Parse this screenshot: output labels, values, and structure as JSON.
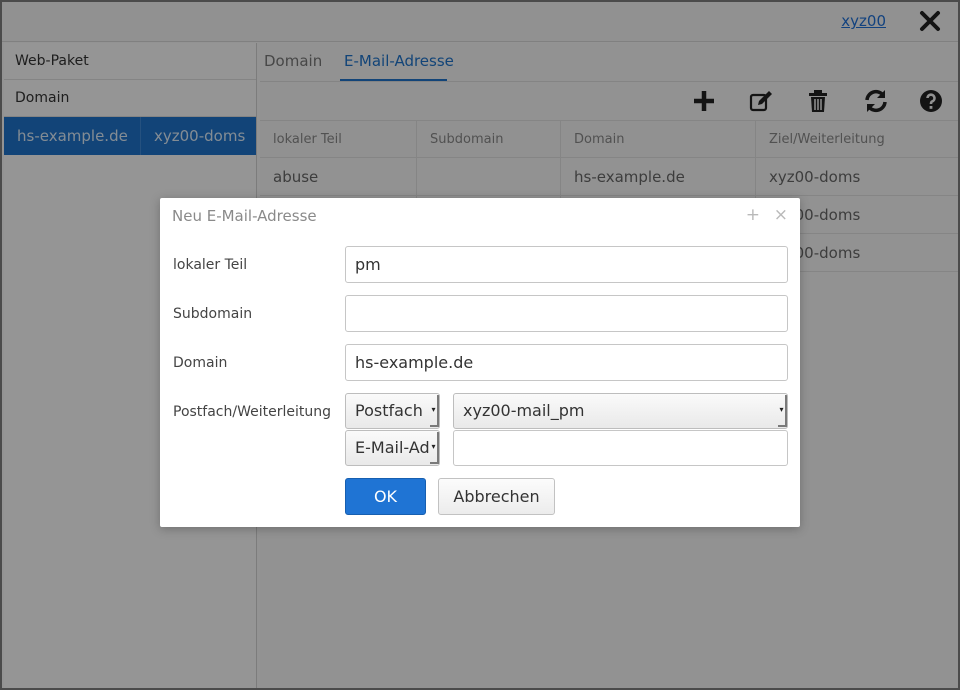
{
  "header": {
    "user": "xyz00",
    "close_icon": "close-icon"
  },
  "sidebar": {
    "items": [
      {
        "label": "Web-Paket"
      },
      {
        "label": "Domain"
      }
    ],
    "selected_row": {
      "domain": "hs-example.de",
      "owner": "xyz00-doms"
    }
  },
  "main": {
    "tabs": [
      {
        "label": "Domain",
        "active": false
      },
      {
        "label": "E-Mail-Adresse",
        "active": true
      }
    ],
    "toolbar": [
      "plus-icon",
      "edit-icon",
      "trash-icon",
      "refresh-icon",
      "help-icon"
    ],
    "table": {
      "columns": [
        "lokaler Teil",
        "Subdomain",
        "Domain",
        "Ziel/Weiterleitung"
      ],
      "rows": [
        [
          "abuse",
          "",
          "hs-example.de",
          "xyz00-doms"
        ],
        [
          "",
          "",
          "",
          "xyz00-doms"
        ],
        [
          "",
          "",
          "",
          "xyz00-doms"
        ]
      ]
    }
  },
  "dialog": {
    "title": "Neu E-Mail-Adresse",
    "maximize_glyph": "+",
    "close_glyph": "×",
    "fields": {
      "local_part": {
        "label": "lokaler Teil",
        "value": "pm"
      },
      "subdomain": {
        "label": "Subdomain",
        "value": ""
      },
      "domain": {
        "label": "Domain",
        "value": "hs-example.de"
      },
      "target": {
        "label": "Postfach/Weiterleitung",
        "type1": "Postfach",
        "value1": "xyz00-mail_pm",
        "type2": "E-Mail-Ad",
        "value2": ""
      }
    },
    "ok_label": "OK",
    "cancel_label": "Abbrechen"
  },
  "colors": {
    "accent": "#1e72c8",
    "ok_button": "#1f74d4"
  }
}
